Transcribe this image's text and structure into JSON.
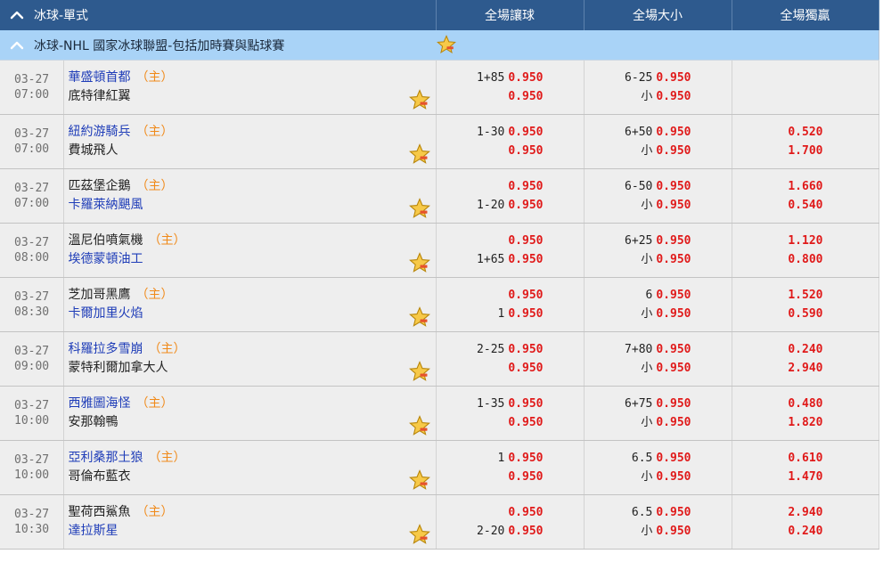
{
  "header": {
    "section_title": "冰球-單式",
    "col_handicap": "全場讓球",
    "col_total": "全場大小",
    "col_moneyline": "全場獨贏"
  },
  "league": {
    "name": "冰球-NHL 國家冰球聯盟-包括加時賽與點球賽"
  },
  "home_mark": "（主）",
  "under_label": "小",
  "icons": {
    "collapse": "chevron-up-icon",
    "favorite": "star-icon"
  },
  "colors": {
    "header_bg": "#2e5a8e",
    "league_bg": "#a9d3f7",
    "odds": "#e01919",
    "home_mark": "#f08a1a",
    "team_link": "#1f3db8"
  },
  "matches": [
    {
      "date": "03-27",
      "time": "07:00",
      "home": "華盛頓首都",
      "away": "底特律紅翼",
      "home_link": true,
      "away_link": false,
      "hc_home_line": "1+85",
      "hc_home_odds": "0.950",
      "hc_away_line": "",
      "hc_away_odds": "0.950",
      "ou_line": "6-25",
      "ou_over_odds": "0.950",
      "ou_under_odds": "0.950",
      "ml_home": "",
      "ml_away": ""
    },
    {
      "date": "03-27",
      "time": "07:00",
      "home": "紐約游騎兵",
      "away": "費城飛人",
      "home_link": true,
      "away_link": false,
      "hc_home_line": "1-30",
      "hc_home_odds": "0.950",
      "hc_away_line": "",
      "hc_away_odds": "0.950",
      "ou_line": "6+50",
      "ou_over_odds": "0.950",
      "ou_under_odds": "0.950",
      "ml_home": "0.520",
      "ml_away": "1.700"
    },
    {
      "date": "03-27",
      "time": "07:00",
      "home": "匹茲堡企鵝",
      "away": "卡羅萊納颶風",
      "home_link": false,
      "away_link": true,
      "hc_home_line": "",
      "hc_home_odds": "0.950",
      "hc_away_line": "1-20",
      "hc_away_odds": "0.950",
      "ou_line": "6-50",
      "ou_over_odds": "0.950",
      "ou_under_odds": "0.950",
      "ml_home": "1.660",
      "ml_away": "0.540"
    },
    {
      "date": "03-27",
      "time": "08:00",
      "home": "溫尼伯噴氣機",
      "away": "埃德蒙頓油工",
      "home_link": false,
      "away_link": true,
      "hc_home_line": "",
      "hc_home_odds": "0.950",
      "hc_away_line": "1+65",
      "hc_away_odds": "0.950",
      "ou_line": "6+25",
      "ou_over_odds": "0.950",
      "ou_under_odds": "0.950",
      "ml_home": "1.120",
      "ml_away": "0.800"
    },
    {
      "date": "03-27",
      "time": "08:30",
      "home": "芝加哥黑鷹",
      "away": "卡爾加里火焰",
      "home_link": false,
      "away_link": true,
      "hc_home_line": "",
      "hc_home_odds": "0.950",
      "hc_away_line": "1",
      "hc_away_odds": "0.950",
      "ou_line": "6",
      "ou_over_odds": "0.950",
      "ou_under_odds": "0.950",
      "ml_home": "1.520",
      "ml_away": "0.590"
    },
    {
      "date": "03-27",
      "time": "09:00",
      "home": "科羅拉多雪崩",
      "away": "蒙特利爾加拿大人",
      "home_link": true,
      "away_link": false,
      "hc_home_line": "2-25",
      "hc_home_odds": "0.950",
      "hc_away_line": "",
      "hc_away_odds": "0.950",
      "ou_line": "7+80",
      "ou_over_odds": "0.950",
      "ou_under_odds": "0.950",
      "ml_home": "0.240",
      "ml_away": "2.940"
    },
    {
      "date": "03-27",
      "time": "10:00",
      "home": "西雅圖海怪",
      "away": "安那翰鴨",
      "home_link": true,
      "away_link": false,
      "hc_home_line": "1-35",
      "hc_home_odds": "0.950",
      "hc_away_line": "",
      "hc_away_odds": "0.950",
      "ou_line": "6+75",
      "ou_over_odds": "0.950",
      "ou_under_odds": "0.950",
      "ml_home": "0.480",
      "ml_away": "1.820"
    },
    {
      "date": "03-27",
      "time": "10:00",
      "home": "亞利桑那土狼",
      "away": "哥倫布藍衣",
      "home_link": true,
      "away_link": false,
      "hc_home_line": "1",
      "hc_home_odds": "0.950",
      "hc_away_line": "",
      "hc_away_odds": "0.950",
      "ou_line": "6.5",
      "ou_over_odds": "0.950",
      "ou_under_odds": "0.950",
      "ml_home": "0.610",
      "ml_away": "1.470"
    },
    {
      "date": "03-27",
      "time": "10:30",
      "home": "聖荷西鯊魚",
      "away": "達拉斯星",
      "home_link": false,
      "away_link": true,
      "hc_home_line": "",
      "hc_home_odds": "0.950",
      "hc_away_line": "2-20",
      "hc_away_odds": "0.950",
      "ou_line": "6.5",
      "ou_over_odds": "0.950",
      "ou_under_odds": "0.950",
      "ml_home": "2.940",
      "ml_away": "0.240"
    }
  ]
}
